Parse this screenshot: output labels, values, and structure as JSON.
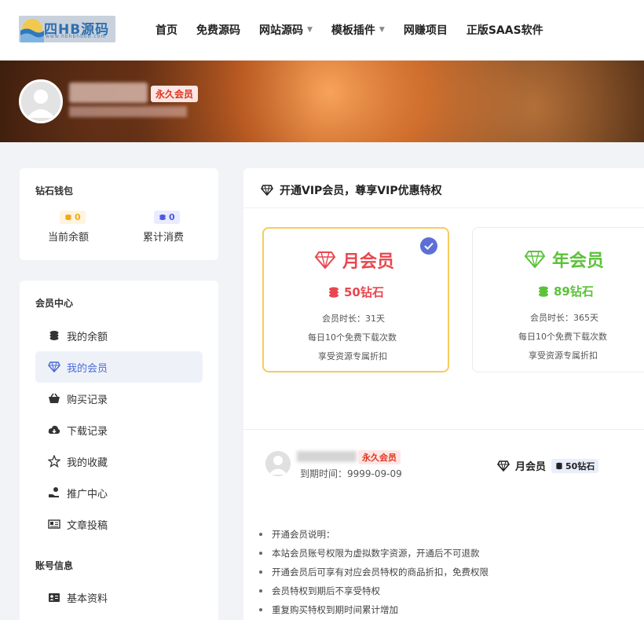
{
  "logo": {
    "text": "四HB源码",
    "sub": "www.hbhbhbbb.com"
  },
  "nav": [
    {
      "label": "首页",
      "dropdown": false
    },
    {
      "label": "免费源码",
      "dropdown": false
    },
    {
      "label": "网站源码",
      "dropdown": true
    },
    {
      "label": "模板插件",
      "dropdown": true
    },
    {
      "label": "网赚项目",
      "dropdown": false
    },
    {
      "label": "正版SAAS软件",
      "dropdown": false
    }
  ],
  "profile": {
    "badge": "永久会员"
  },
  "wallet": {
    "title": "钻石钱包",
    "balance_value": "0",
    "balance_label": "当前余额",
    "spent_value": "0",
    "spent_label": "累计消费"
  },
  "member_center": {
    "title": "会员中心",
    "items": [
      {
        "label": "我的余额",
        "icon": "coins-icon"
      },
      {
        "label": "我的会员",
        "icon": "diamond-icon"
      },
      {
        "label": "购买记录",
        "icon": "basket-icon"
      },
      {
        "label": "下载记录",
        "icon": "cloud-download-icon"
      },
      {
        "label": "我的收藏",
        "icon": "star-icon"
      },
      {
        "label": "推广中心",
        "icon": "hand-coin-icon"
      },
      {
        "label": "文章投稿",
        "icon": "newspaper-icon"
      }
    ]
  },
  "account": {
    "title": "账号信息",
    "items": [
      {
        "label": "基本资料",
        "icon": "id-card-icon"
      }
    ]
  },
  "main": {
    "heading": "开通VIP会员，尊享VIP优惠特权",
    "plans": [
      {
        "name": "月会员",
        "price": "50钻石",
        "duration": "会员时长：31天",
        "downloads": "每日10个免费下载次数",
        "discount": "享受资源专属折扣",
        "color": "#e8474f",
        "selected": true
      },
      {
        "name": "年会员",
        "price": "89钻石",
        "duration": "会员时长：365天",
        "downloads": "每日10个免费下载次数",
        "discount": "享受资源专属折扣",
        "color": "#5cc23a",
        "selected": false
      }
    ],
    "current": {
      "badge": "永久会员",
      "expire": "到期时间：9999-09-09",
      "plan_name": "月会员",
      "plan_price": "50钻石"
    },
    "notes": [
      "开通会员说明：",
      "本站会员账号权限为虚拟数字资源，开通后不可退款",
      "开通会员后可享有对应会员特权的商品折扣，免费权限",
      "会员特权到期后不享受特权",
      "重复购买特权到期时间累计增加"
    ]
  },
  "colors": {
    "accent": "#5b6fd6",
    "gold": "#f7cc5c",
    "red_badge": "#e0341f"
  }
}
